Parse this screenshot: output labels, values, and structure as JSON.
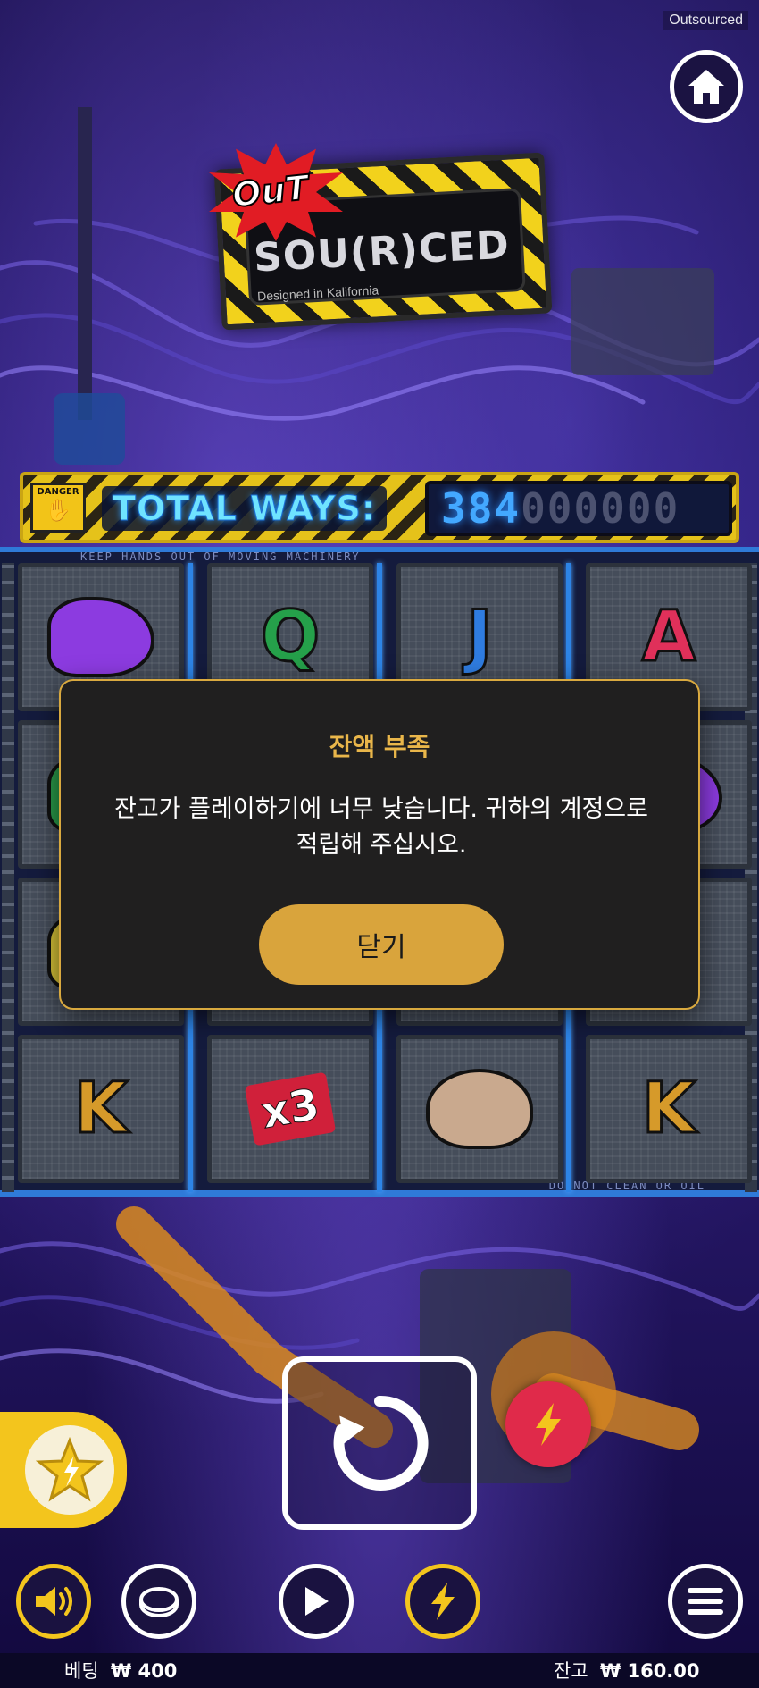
{
  "header": {
    "brand_tag": "Outsourced",
    "home_icon": "home-icon"
  },
  "logo": {
    "out": "OuT",
    "main": "SOU(R)CED",
    "sub": "Designed in Kalifornia"
  },
  "ways": {
    "danger_label": "DANGER",
    "label": "TOTAL WAYS:",
    "lit_value": "384",
    "dim_value": "000000"
  },
  "reels": {
    "warn_top": "KEEP HANDS OUT OF MOVING MACHINERY",
    "warn_bottom": "DO NOT CLEAN OR OIL",
    "columns": [
      [
        {
          "text": "",
          "icon": "sneaker-icon",
          "color": "#8c3be0"
        },
        {
          "text": "",
          "icon": "cable-icon",
          "color": "#2a9c4a"
        },
        {
          "text": "",
          "icon": "banana-icon",
          "color": "#d8c338"
        },
        {
          "text": "K",
          "icon": "k-symbol",
          "color": "#d69a2a"
        }
      ],
      [
        {
          "text": "Q",
          "icon": "q-symbol",
          "color": "#25a04a"
        },
        {
          "text": "",
          "icon": "blank",
          "color": "#444"
        },
        {
          "text": "",
          "icon": "blank",
          "color": "#444"
        },
        {
          "text": "x3",
          "icon": "multiplier-icon",
          "color": "#d0203a"
        }
      ],
      [
        {
          "text": "J",
          "icon": "j-symbol",
          "color": "#2f7ce0"
        },
        {
          "text": "",
          "icon": "blank",
          "color": "#444"
        },
        {
          "text": "",
          "icon": "blank",
          "color": "#444"
        },
        {
          "text": "",
          "icon": "doll-head-icon",
          "color": "#c9a98e"
        }
      ],
      [
        {
          "text": "A",
          "icon": "a-symbol",
          "color": "#e0305a"
        },
        {
          "text": "",
          "icon": "sneaker-icon",
          "color": "#8c3be0"
        },
        {
          "text": "",
          "icon": "blank",
          "color": "#444"
        },
        {
          "text": "K",
          "icon": "k-symbol",
          "color": "#d69a2a"
        }
      ]
    ]
  },
  "modal": {
    "title": "잔액 부족",
    "message": "잔고가 플레이하기에 너무 낮습니다. 귀하의 계정으로 적립해 주십시오.",
    "close_label": "닫기"
  },
  "controls": {
    "spin_icon": "spin-icon",
    "feature_icon": "star-bolt-icon",
    "turbo_icon": "lightning-icon",
    "sound_icon": "sound-icon",
    "coin_icon": "coin-icon",
    "autoplay_icon": "play-icon",
    "quick_icon": "lightning-icon",
    "menu_icon": "menu-icon"
  },
  "footer": {
    "bet_label": "베팅",
    "bet_value": "₩ 400",
    "balance_label": "잔고",
    "balance_value": "₩ 160.00"
  },
  "colors": {
    "accent_gold": "#d9a43c",
    "title_gold": "#e9b64a",
    "ways_cyan": "#6fe3ff",
    "reel_divider": "#2d84e6",
    "turbo_red": "#e02a4a",
    "feature_yellow": "#f3c51d"
  }
}
